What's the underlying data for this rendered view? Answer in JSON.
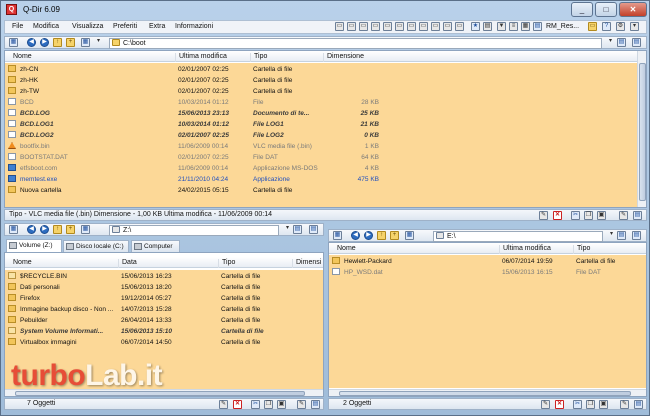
{
  "window": {
    "title": "Q-Dir 6.09",
    "buttons": {
      "minimize": "_",
      "maximize": "□",
      "close": "✕"
    }
  },
  "menu": [
    "File",
    "Modifica",
    "Visualizza",
    "Preferiti",
    "Extra",
    "Informazioni"
  ],
  "toolbar_right": {
    "profile_label": "RM_Res...",
    "help": "?"
  },
  "panes": {
    "top": {
      "path": "C:\\boot",
      "columns": [
        "Nome",
        "Ultima modifica",
        "Tipo",
        "Dimensione"
      ],
      "rows": [
        {
          "name": "zh-CN",
          "date": "02/01/2007 02:25",
          "type": "Cartella di file",
          "size": "",
          "icon": "folder",
          "style": "normal"
        },
        {
          "name": "zh-HK",
          "date": "02/01/2007 02:25",
          "type": "Cartella di file",
          "size": "",
          "icon": "folder",
          "style": "normal"
        },
        {
          "name": "zh-TW",
          "date": "02/01/2007 02:25",
          "type": "Cartella di file",
          "size": "",
          "icon": "folder",
          "style": "normal"
        },
        {
          "name": "BCD",
          "date": "10/03/2014 01:12",
          "type": "File",
          "size": "28 KB",
          "icon": "file",
          "style": "gray"
        },
        {
          "name": "BCD.LOG",
          "date": "15/06/2013 23:13",
          "type": "Documento di te...",
          "size": "25 KB",
          "icon": "file",
          "style": "bolditalic"
        },
        {
          "name": "BCD.LOG1",
          "date": "10/03/2014 01:12",
          "type": "File LOG1",
          "size": "21 KB",
          "icon": "file",
          "style": "bolditalic"
        },
        {
          "name": "BCD.LOG2",
          "date": "02/01/2007 02:25",
          "type": "File LOG2",
          "size": "0 KB",
          "icon": "file",
          "style": "bolditalic"
        },
        {
          "name": "bootfix.bin",
          "date": "11/06/2009 00:14",
          "type": "VLC media file (.bin)",
          "size": "1 KB",
          "icon": "vlc",
          "style": "gray"
        },
        {
          "name": "BOOTSTAT.DAT",
          "date": "02/01/2007 02:25",
          "type": "File DAT",
          "size": "64 KB",
          "icon": "file",
          "style": "gray"
        },
        {
          "name": "etfsboot.com",
          "date": "11/06/2009 00:14",
          "type": "Applicazione MS-DOS",
          "size": "4 KB",
          "icon": "app",
          "style": "gray"
        },
        {
          "name": "memtest.exe",
          "date": "21/11/2010 04:24",
          "type": "Applicazione",
          "size": "475 KB",
          "icon": "app",
          "style": "blue"
        },
        {
          "name": "Nuova cartella",
          "date": "24/02/2015 05:15",
          "type": "Cartella di file",
          "size": "",
          "icon": "folder",
          "style": "normal"
        }
      ],
      "status": "Tipo - VLC media file (.bin) Dimensione - 1,00 KB Ultima modifica - 11/06/2009 00:14"
    },
    "bottom_left": {
      "tabs": [
        "Volume (Z:)",
        "Disco locale (C:)",
        "Computer"
      ],
      "path": "Z:\\",
      "columns": [
        "Nome",
        "Data",
        "Tipo",
        "Dimensi"
      ],
      "rows": [
        {
          "name": "$RECYCLE.BIN",
          "date": "15/06/2013 16:23",
          "type": "Cartella di file",
          "icon": "sys",
          "style": "normal"
        },
        {
          "name": "Dati personali",
          "date": "15/06/2013 18:20",
          "type": "Cartella di file",
          "icon": "folder",
          "style": "normal"
        },
        {
          "name": "Firefox",
          "date": "19/12/2014 05:27",
          "type": "Cartella di file",
          "icon": "folder",
          "style": "normal"
        },
        {
          "name": "Immagine backup disco - Non ...",
          "date": "14/07/2013 15:28",
          "type": "Cartella di file",
          "icon": "folder",
          "style": "normal"
        },
        {
          "name": "Pebuilder",
          "date": "26/04/2014 13:33",
          "type": "Cartella di file",
          "icon": "folder",
          "style": "normal"
        },
        {
          "name": "System Volume Informati...",
          "date": "15/06/2013 15:10",
          "type": "Cartella di file",
          "icon": "sys",
          "style": "bolditalic"
        },
        {
          "name": "Virtualbox immagini",
          "date": "06/07/2014 14:50",
          "type": "Cartella di file",
          "icon": "folder",
          "style": "normal"
        }
      ],
      "status": "7 Oggetti"
    },
    "bottom_right": {
      "path": "E:\\",
      "columns": [
        "Nome",
        "Ultima modifica",
        "Tipo"
      ],
      "rows": [
        {
          "name": "Hewlett-Packard",
          "date": "06/07/2014 19:59",
          "type": "Cartella di file",
          "icon": "folder",
          "style": "normal"
        },
        {
          "name": "HP_WSD.dat",
          "date": "15/06/2013 16:15",
          "type": "File DAT",
          "icon": "file",
          "style": "gray"
        }
      ],
      "status": "2 Oggetti"
    }
  },
  "watermark": {
    "part1": "turbo",
    "part2": "Lab.it"
  },
  "colors": {
    "highlight": "#fcd897",
    "gray_text": "#7a7a7a",
    "blue_text": "#1f4fbf"
  }
}
